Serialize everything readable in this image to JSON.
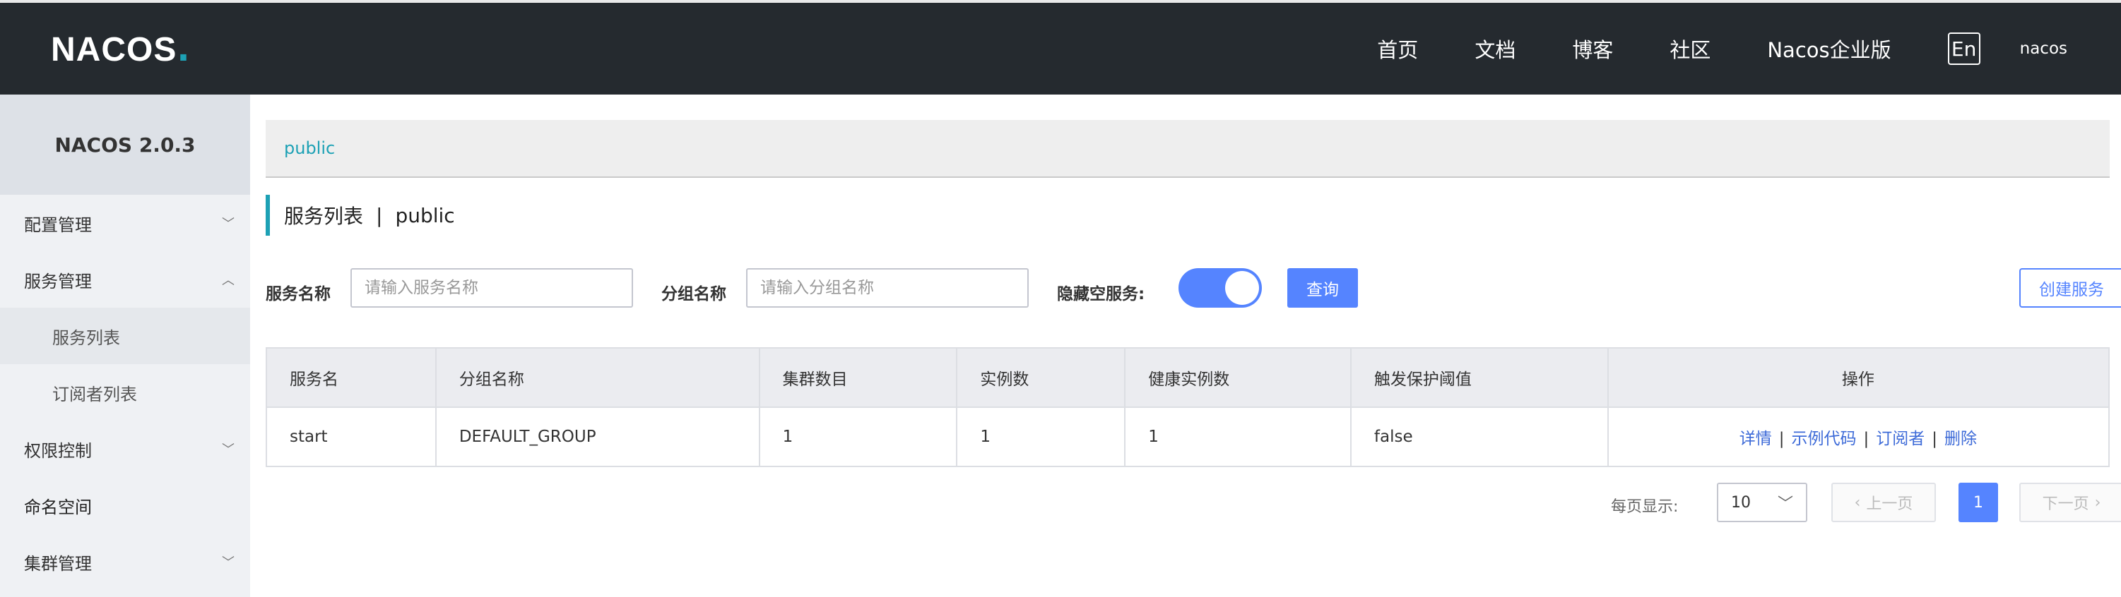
{
  "header": {
    "logo": "NACOS",
    "nav": [
      "首页",
      "文档",
      "博客",
      "社区",
      "Nacos企业版"
    ],
    "lang": "En",
    "user": "nacos"
  },
  "sidebar": {
    "version": "NACOS 2.0.3",
    "items": [
      {
        "label": "配置管理",
        "icon": "chevron-down-icon"
      },
      {
        "label": "服务管理",
        "icon": "chevron-up-icon"
      },
      {
        "label": "服务列表"
      },
      {
        "label": "订阅者列表"
      },
      {
        "label": "权限控制",
        "icon": "chevron-down-icon"
      },
      {
        "label": "命名空间"
      },
      {
        "label": "集群管理",
        "icon": "chevron-down-icon"
      }
    ]
  },
  "namespace": "public",
  "page": {
    "title": "服务列表",
    "separator": "|",
    "namespace": "public"
  },
  "filters": {
    "service_label": "服务名称",
    "service_placeholder": "请输入服务名称",
    "group_label": "分组名称",
    "group_placeholder": "请输入分组名称",
    "hide_empty_label": "隐藏空服务:",
    "hide_empty_on": true,
    "query_button": "查询",
    "create_button": "创建服务"
  },
  "table": {
    "columns": [
      "服务名",
      "分组名称",
      "集群数目",
      "实例数",
      "健康实例数",
      "触发保护阈值",
      "操作"
    ],
    "rows": [
      {
        "service": "start",
        "group": "DEFAULT_GROUP",
        "clusters": "1",
        "instances": "1",
        "healthy": "1",
        "threshold": "false"
      }
    ],
    "actions": [
      "详情",
      "示例代码",
      "订阅者",
      "删除"
    ]
  },
  "pagination": {
    "page_size_label": "每页显示:",
    "page_size": "10",
    "prev": "上一页",
    "current": "1",
    "next": "下一页"
  },
  "colors": {
    "header_bg": "#252a2f",
    "accent": "#1da1b5",
    "primary": "#5584ff"
  }
}
